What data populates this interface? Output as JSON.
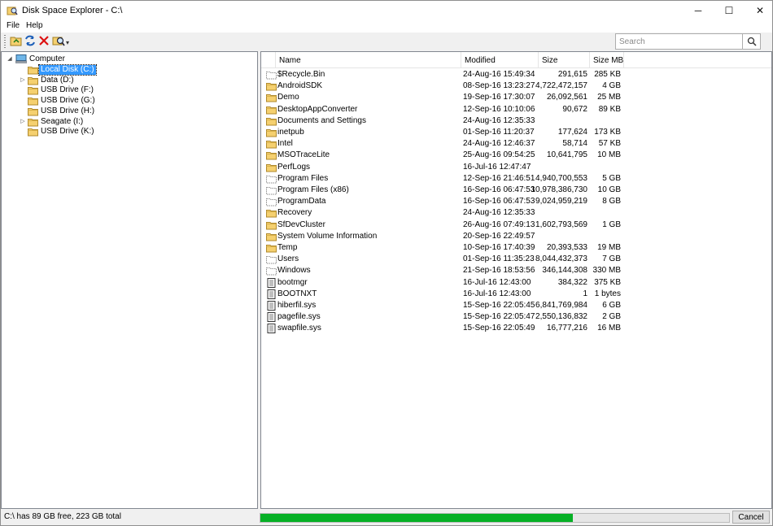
{
  "window": {
    "title": "Disk Space Explorer - C:\\"
  },
  "window_buttons": {
    "minimize": "─",
    "maximize": "☐",
    "close": "✕"
  },
  "menu": [
    {
      "label": "File"
    },
    {
      "label": "Help"
    }
  ],
  "toolbar": {
    "buttons": [
      {
        "icon": "open-folder-icon"
      },
      {
        "icon": "refresh-icon"
      },
      {
        "icon": "delete-icon"
      },
      {
        "icon": "search-folder-icon"
      }
    ],
    "overflow": "▾"
  },
  "search": {
    "placeholder": "Search",
    "value": ""
  },
  "tree": {
    "root": {
      "label": "Computer",
      "expander": "◢"
    },
    "items": [
      {
        "label": "Local Disk (C:)",
        "selected": true
      },
      {
        "label": "Data (D:)",
        "selected": false
      },
      {
        "label": "USB Drive (F:)",
        "selected": false
      },
      {
        "label": "USB Drive (G:)",
        "selected": false
      },
      {
        "label": "USB Drive (H:)",
        "selected": false
      },
      {
        "label": "Seagate (I:)",
        "selected": false
      },
      {
        "label": "USB Drive (K:)",
        "selected": false
      }
    ],
    "expander_collapsed": "▷"
  },
  "list": {
    "columns": [
      {
        "label": "Name"
      },
      {
        "label": "Modified"
      },
      {
        "label": "Size"
      },
      {
        "label": "Size MB"
      }
    ],
    "rows": [
      {
        "name": "$Recycle.Bin",
        "modified": "24-Aug-16 15:49:34",
        "size": "291,615",
        "size_mb": "285 KB",
        "icon": "special-folder-icon"
      },
      {
        "name": "AndroidSDK",
        "modified": "08-Sep-16 13:23:27",
        "size": "4,722,472,157",
        "size_mb": "4 GB",
        "icon": "folder-icon"
      },
      {
        "name": "Demo",
        "modified": "19-Sep-16 17:30:07",
        "size": "26,092,561",
        "size_mb": "25 MB",
        "icon": "folder-icon"
      },
      {
        "name": "DesktopAppConverter",
        "modified": "12-Sep-16 10:10:06",
        "size": "90,672",
        "size_mb": "89 KB",
        "icon": "folder-icon"
      },
      {
        "name": "Documents and Settings",
        "modified": "24-Aug-16 12:35:33",
        "size": "",
        "size_mb": "",
        "icon": "folder-icon"
      },
      {
        "name": "inetpub",
        "modified": "01-Sep-16 11:20:37",
        "size": "177,624",
        "size_mb": "173 KB",
        "icon": "folder-icon"
      },
      {
        "name": "Intel",
        "modified": "24-Aug-16 12:46:37",
        "size": "58,714",
        "size_mb": "57 KB",
        "icon": "folder-icon"
      },
      {
        "name": "MSOTraceLite",
        "modified": "25-Aug-16 09:54:25",
        "size": "10,641,795",
        "size_mb": "10 MB",
        "icon": "folder-icon"
      },
      {
        "name": "PerfLogs",
        "modified": "16-Jul-16 12:47:47",
        "size": "",
        "size_mb": "",
        "icon": "folder-icon"
      },
      {
        "name": "Program Files",
        "modified": "12-Sep-16 21:46:51",
        "size": "4,940,700,553",
        "size_mb": "5 GB",
        "icon": "special-folder-icon"
      },
      {
        "name": "Program Files (x86)",
        "modified": "16-Sep-16 06:47:53",
        "size": "10,978,386,730",
        "size_mb": "10 GB",
        "icon": "special-folder-icon"
      },
      {
        "name": "ProgramData",
        "modified": "16-Sep-16 06:47:53",
        "size": "9,024,959,219",
        "size_mb": "8 GB",
        "icon": "special-folder-icon"
      },
      {
        "name": "Recovery",
        "modified": "24-Aug-16 12:35:33",
        "size": "",
        "size_mb": "",
        "icon": "folder-icon"
      },
      {
        "name": "SfDevCluster",
        "modified": "26-Aug-16 07:49:13",
        "size": "1,602,793,569",
        "size_mb": "1 GB",
        "icon": "folder-icon"
      },
      {
        "name": "System Volume Information",
        "modified": "20-Sep-16 22:49:57",
        "size": "",
        "size_mb": "",
        "icon": "folder-icon"
      },
      {
        "name": "Temp",
        "modified": "10-Sep-16 17:40:39",
        "size": "20,393,533",
        "size_mb": "19 MB",
        "icon": "folder-icon"
      },
      {
        "name": "Users",
        "modified": "01-Sep-16 11:35:23",
        "size": "8,044,432,373",
        "size_mb": "7 GB",
        "icon": "special-folder-icon"
      },
      {
        "name": "Windows",
        "modified": "21-Sep-16 18:53:56",
        "size": "346,144,308",
        "size_mb": "330 MB",
        "icon": "special-folder-icon"
      },
      {
        "name": "bootmgr",
        "modified": "16-Jul-16 12:43:00",
        "size": "384,322",
        "size_mb": "375 KB",
        "icon": "file-icon"
      },
      {
        "name": "BOOTNXT",
        "modified": "16-Jul-16 12:43:00",
        "size": "1",
        "size_mb": "1 bytes",
        "icon": "file-icon"
      },
      {
        "name": "hiberfil.sys",
        "modified": "15-Sep-16 22:05:45",
        "size": "6,841,769,984",
        "size_mb": "6 GB",
        "icon": "file-icon"
      },
      {
        "name": "pagefile.sys",
        "modified": "15-Sep-16 22:05:47",
        "size": "2,550,136,832",
        "size_mb": "2 GB",
        "icon": "file-icon"
      },
      {
        "name": "swapfile.sys",
        "modified": "15-Sep-16 22:05:49",
        "size": "16,777,216",
        "size_mb": "16 MB",
        "icon": "file-icon"
      }
    ]
  },
  "status": {
    "text": "C:\\ has 89 GB free, 223 GB total",
    "progress_fraction": 0.666,
    "cancel_label": "Cancel"
  },
  "colors": {
    "selection": "#3399ff",
    "progress": "#06b025",
    "folder": "#f5d06f"
  }
}
